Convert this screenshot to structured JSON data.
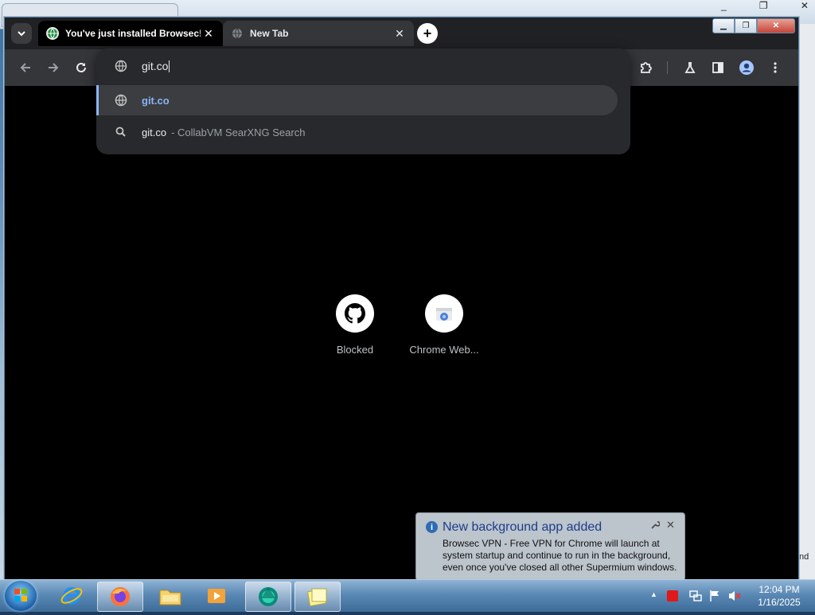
{
  "background": {
    "tab1_text": "",
    "window_controls": [
      "_",
      "❐",
      "✕"
    ],
    "edge_text": "nd"
  },
  "browser": {
    "tabs": [
      {
        "title": "You've just installed Browsec!",
        "close": "✕"
      },
      {
        "title": "New Tab",
        "close": "✕"
      }
    ],
    "new_tab_symbol": "+",
    "window_controls": {
      "minimize": "▁",
      "maximize": "❐",
      "close": "✕"
    }
  },
  "omnibox": {
    "input_value": "git.co",
    "suggestions": [
      {
        "text": "git.co",
        "description": "",
        "icon": "globe-icon"
      },
      {
        "text": "git.co",
        "description": "- CollabVM SearXNG Search",
        "icon": "search-icon"
      }
    ]
  },
  "shortcuts": [
    {
      "label": "Blocked",
      "icon": "github-icon"
    },
    {
      "label": "Chrome Web...",
      "icon": "chrome-web-store-icon"
    }
  ],
  "notification": {
    "title": "New background app added",
    "body": "Browsec VPN - Free VPN for Chrome will launch at system startup and continue to run in the background, even once you've closed all other Supermium windows.",
    "close": "✕"
  },
  "taskbar": {
    "apps": [
      "internet-explorer-icon",
      "firefox-icon",
      "file-explorer-icon",
      "media-player-icon",
      "supermium-icon",
      "sticky-notes-icon"
    ],
    "tray_expand": "▲",
    "clock_time": "12:04 PM",
    "clock_date": "1/16/2025"
  },
  "colors": {
    "accent": "#8ab4f8",
    "notification_title": "#1c3d8a",
    "browser_background": "#000000"
  }
}
